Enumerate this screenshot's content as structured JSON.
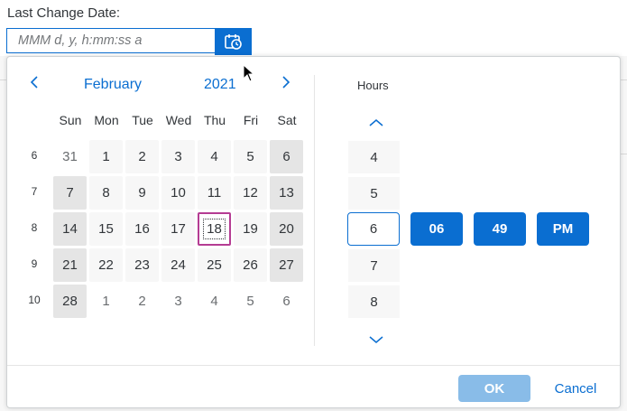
{
  "field": {
    "label": "Last Change Date:",
    "placeholder": "MMM d, y, h:mm:ss a",
    "value": ""
  },
  "calendar": {
    "month": "February",
    "year": "2021",
    "weekdays": [
      "Sun",
      "Mon",
      "Tue",
      "Wed",
      "Thu",
      "Fri",
      "Sat"
    ],
    "weeks": [
      {
        "number": "6",
        "days": [
          "31",
          "1",
          "2",
          "3",
          "4",
          "5",
          "6"
        ]
      },
      {
        "number": "7",
        "days": [
          "7",
          "8",
          "9",
          "10",
          "11",
          "12",
          "13"
        ]
      },
      {
        "number": "8",
        "days": [
          "14",
          "15",
          "16",
          "17",
          "18",
          "19",
          "20"
        ]
      },
      {
        "number": "9",
        "days": [
          "21",
          "22",
          "23",
          "24",
          "25",
          "26",
          "27"
        ]
      },
      {
        "number": "10",
        "days": [
          "28",
          "1",
          "2",
          "3",
          "4",
          "5",
          "6"
        ]
      }
    ],
    "today": "18"
  },
  "time": {
    "hours_label": "Hours",
    "hours": [
      "4",
      "5",
      "6",
      "7",
      "8"
    ],
    "selected_hour": "6",
    "minutes": "06",
    "seconds": "49",
    "period": "PM"
  },
  "footer": {
    "ok_label": "OK",
    "cancel_label": "Cancel"
  },
  "colors": {
    "accent": "#0a6ed1",
    "today_border": "#b53c93",
    "weekend_bg": "#e5e5e5",
    "ok_disabled": "#89bce8"
  }
}
